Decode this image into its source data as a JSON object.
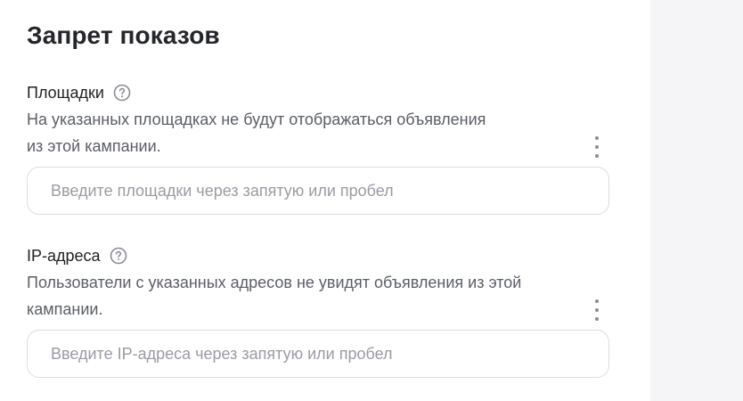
{
  "title": "Запрет показов",
  "sections": [
    {
      "label": "Площадки",
      "help_icon": "question-circle-icon",
      "description_line1": "На указанных площадках не будут отображаться объявления",
      "description_line2": "из этой кампании.",
      "more_icon": "vertical-dots-icon",
      "input_value": "",
      "input_placeholder": "Введите площадки через запятую или пробел"
    },
    {
      "label": "IP-адреса",
      "help_icon": "question-circle-icon",
      "description_line1": "Пользователи с указанных адресов не увидят объявления из этой",
      "description_line2": "кампании.",
      "more_icon": "vertical-dots-icon",
      "input_value": "",
      "input_placeholder": "Введите IP-адреса через запятую или пробел"
    }
  ],
  "colors": {
    "text_primary": "#1f2024",
    "text_secondary": "#5b5e66",
    "placeholder": "#9a9ca3",
    "border": "#dcdde2",
    "side_panel": "#f5f5f7"
  }
}
